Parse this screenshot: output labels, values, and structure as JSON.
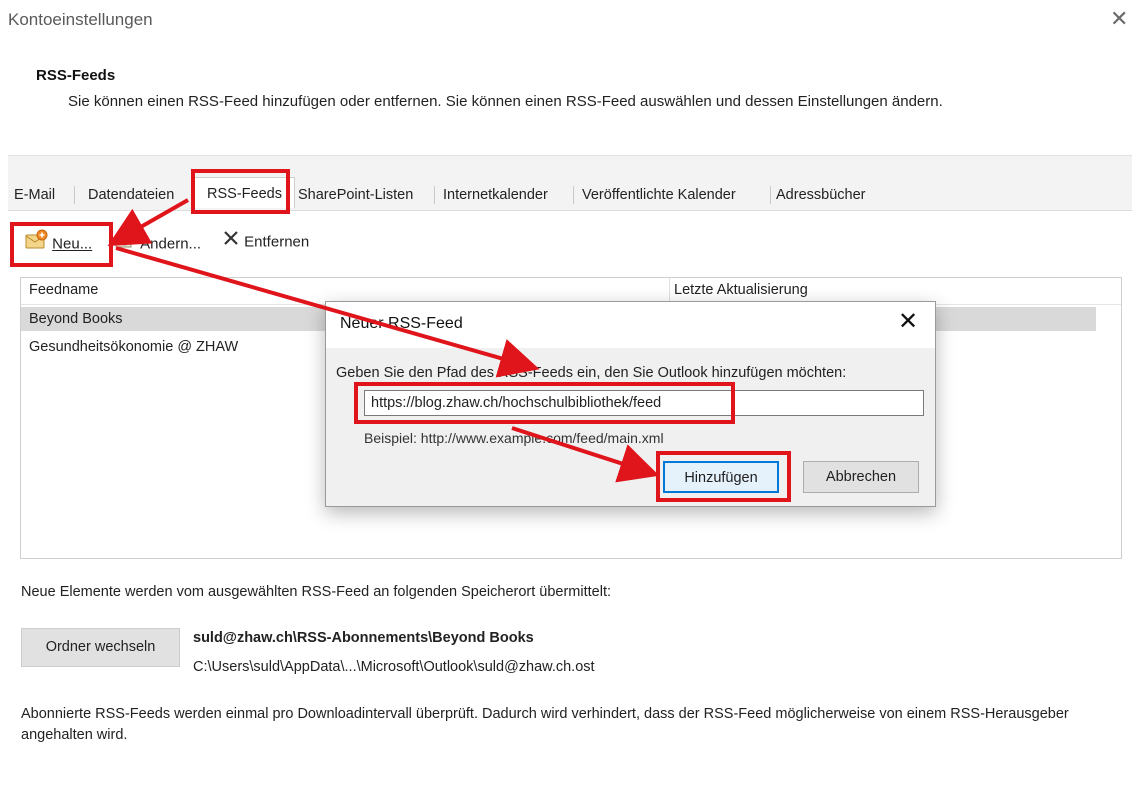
{
  "window": {
    "title": "Kontoeinstellungen",
    "close_glyph": "✕"
  },
  "section": {
    "title": "RSS-Feeds",
    "description": "Sie können einen RSS-Feed hinzufügen oder entfernen. Sie können einen RSS-Feed auswählen und dessen Einstellungen ändern."
  },
  "tabs": [
    {
      "label": "E-Mail"
    },
    {
      "label": "Datendateien"
    },
    {
      "label": "RSS-Feeds"
    },
    {
      "label": "SharePoint-Listen"
    },
    {
      "label": "Internetkalender"
    },
    {
      "label": "Veröffentlichte Kalender"
    },
    {
      "label": "Adressbücher"
    }
  ],
  "toolbar": {
    "new_label": "Neu...",
    "change_label": "Ändern...",
    "remove_label": "Entfernen"
  },
  "feed_list": {
    "columns": [
      "Feedname",
      "Letzte Aktualisierung"
    ],
    "rows": [
      {
        "name": "Beyond Books",
        "last_update": ""
      },
      {
        "name": "Gesundheitsökonomie @ ZHAW",
        "last_update": ""
      }
    ]
  },
  "delivery": {
    "info": "Neue Elemente werden vom ausgewählten RSS-Feed an folgenden Speicherort übermittelt:",
    "change_folder_label": "Ordner wechseln",
    "folder_path": "suld@zhaw.ch\\RSS-Abonnements\\Beyond Books",
    "file_path": "C:\\Users\\suld\\AppData\\...\\Microsoft\\Outlook\\suld@zhaw.ch.ost"
  },
  "footer_note": "Abonnierte RSS-Feeds werden einmal pro Downloadintervall überprüft. Dadurch wird verhindert, dass der RSS-Feed möglicherweise von einem RSS-Herausgeber angehalten wird.",
  "dialog": {
    "title": "Neuer RSS-Feed",
    "close_glyph": "✕",
    "prompt": "Geben Sie den Pfad des RSS-Feeds ein, den Sie Outlook hinzufügen möchten:",
    "url_value": "https://blog.zhaw.ch/hochschulbibliothek/feed",
    "example": "Beispiel: http://www.example.com/feed/main.xml",
    "add_label": "Hinzufügen",
    "cancel_label": "Abbrechen"
  },
  "colors": {
    "highlight": "#e0141b",
    "accent": "#0078d7",
    "selected_row": "#d9d9d9"
  },
  "icons": {
    "new": "rss-feed-new-icon",
    "change": "edit-icon",
    "remove": "close-x-icon"
  }
}
